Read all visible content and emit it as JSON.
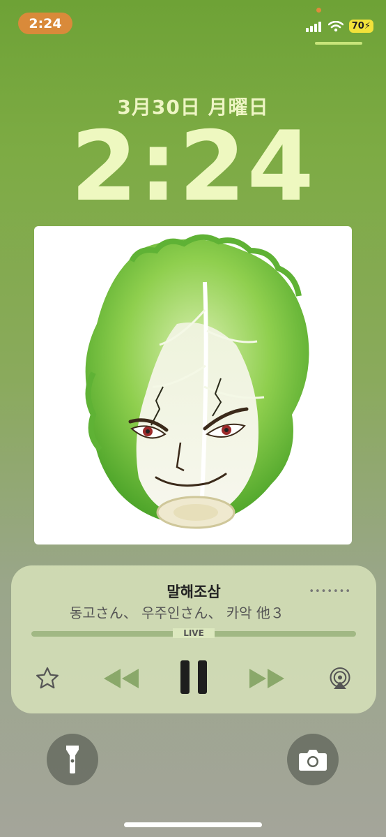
{
  "status_bar": {
    "time": "2:24",
    "battery": "70"
  },
  "lock_screen": {
    "date": "3月30日 月曜日",
    "time": "2:24"
  },
  "now_playing": {
    "title": "말해조삼",
    "artist": "동고さん、 우주인さん、 카악 他３",
    "live_label": "LIVE",
    "colors": {
      "accent": "#7dab44",
      "panel": "#dce8be"
    }
  },
  "icons": {
    "favorite": "star-icon",
    "rewind": "rewind-icon",
    "pause": "pause-icon",
    "forward": "fast-forward-icon",
    "airplay": "airplay-icon",
    "flashlight": "flashlight-icon",
    "camera": "camera-icon"
  }
}
